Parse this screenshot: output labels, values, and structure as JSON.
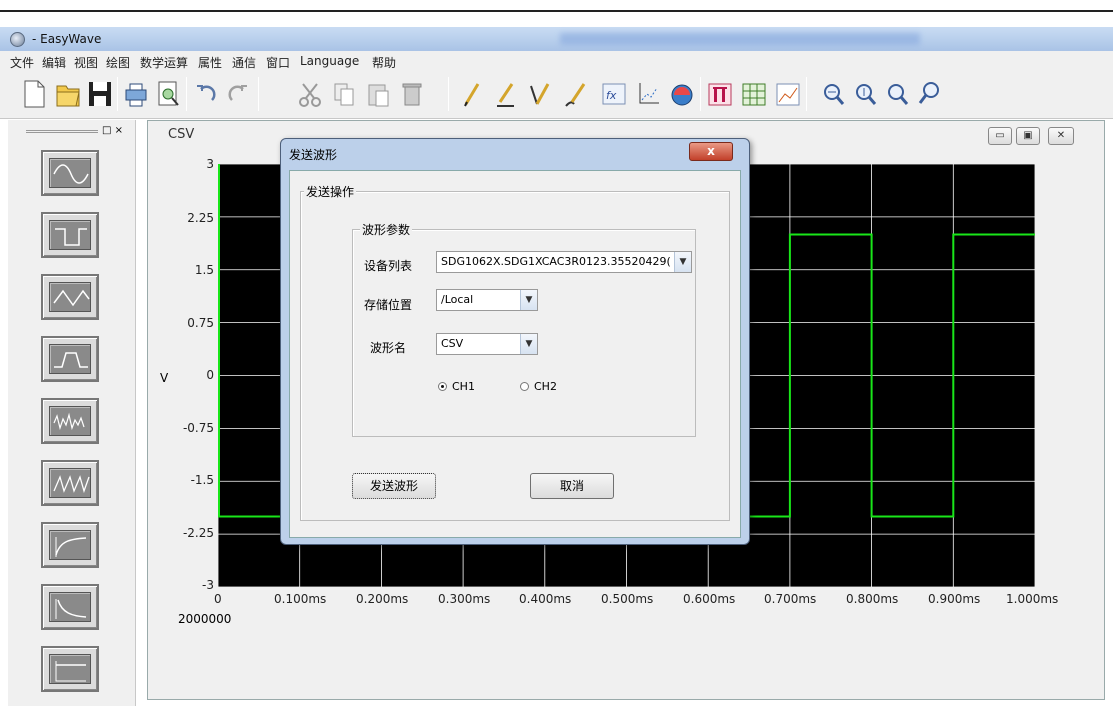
{
  "app": {
    "title": "- EasyWave"
  },
  "menu": [
    "文件",
    "编辑",
    "视图",
    "绘图",
    "数学运算",
    "属性",
    "通信",
    "窗口",
    "Language",
    "帮助"
  ],
  "toolbar_icons": [
    "new-file-icon",
    "open-folder-icon",
    "save-icon",
    "print-icon",
    "print-preview-icon",
    "undo-icon",
    "redo-icon",
    "cut-icon",
    "copy-icon",
    "paste-icon",
    "delete-icon",
    "pencil-icon",
    "line-draw-icon",
    "v-draw-icon",
    "freehand-icon",
    "function-icon",
    "coordinates-icon",
    "gauge-icon",
    "bar-chart-icon",
    "grid-icon",
    "chart-icon",
    "zoom-in-x-icon",
    "zoom-y-icon",
    "zoom-out-icon",
    "zoom-reset-icon"
  ],
  "left_panel": {
    "controls": "□ ×",
    "buttons": [
      "sine-wave-icon",
      "square-wave-icon",
      "triangle-wave-icon",
      "pulse-wave-icon",
      "noise-wave-icon",
      "sawtooth-wave-icon",
      "exp-rise-icon",
      "exp-fall-icon",
      "dc-wave-icon"
    ]
  },
  "mdi": {
    "title": "CSV",
    "controls": [
      "▭",
      "▣",
      "✕"
    ]
  },
  "chart": {
    "ylabel": "V",
    "yticks": [
      "3",
      "2.25",
      "1.5",
      "0.75",
      "0",
      "-0.75",
      "-1.5",
      "-2.25",
      "-3"
    ],
    "xticks": [
      "0",
      "0.100ms",
      "0.200ms",
      "0.300ms",
      "0.400ms",
      "0.500ms",
      "0.600ms",
      "0.700ms",
      "0.800ms",
      "0.900ms",
      "1.000ms"
    ],
    "scale_label": "2000000",
    "line_color": "#19e619"
  },
  "chart_data": {
    "type": "line",
    "xlabel": "",
    "ylabel": "V",
    "xlim": [
      0,
      1.0
    ],
    "ylim": [
      -3,
      3
    ],
    "grid": true,
    "series": [
      {
        "x": [
          0,
          0.001,
          0.001,
          0.7,
          0.7,
          0.8,
          0.8,
          0.9,
          0.9,
          1.0
        ],
        "y": [
          -2.0,
          -2.0,
          -2.0,
          -2.0,
          2.0,
          2.0,
          -2.0,
          -2.0,
          2.0,
          2.0
        ]
      }
    ]
  },
  "dialog": {
    "title": "发送波形",
    "close": "x",
    "group_outer": "发送操作",
    "group_inner": "波形参数",
    "device_label": "设备列表",
    "device_value": "SDG1062X.SDG1XCAC3R0123.35520429(",
    "storage_label": "存储位置",
    "storage_value": "/Local",
    "wave_name_label": "波形名",
    "wave_name_value": "CSV",
    "ch1": "CH1",
    "ch2": "CH2",
    "send_button": "发送波形",
    "cancel_button": "取消"
  }
}
